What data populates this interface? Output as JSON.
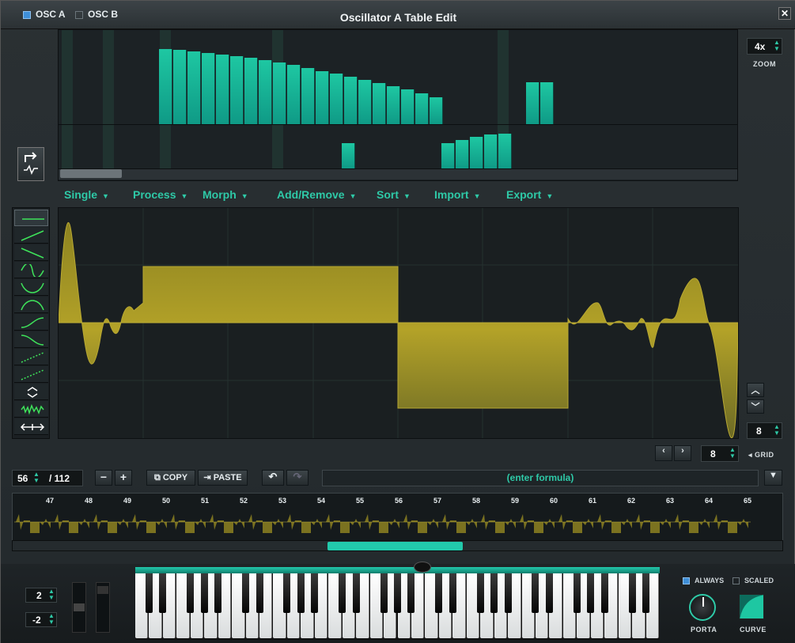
{
  "window": {
    "title": "Oscillator A Table Edit",
    "tabs": [
      {
        "label": "OSC A",
        "checked": true
      },
      {
        "label": "OSC B",
        "checked": false
      }
    ],
    "close_icon": "close-icon"
  },
  "zoom": {
    "value": "4x",
    "label": "ZOOM"
  },
  "menus": [
    {
      "label": "Single"
    },
    {
      "label": "Process"
    },
    {
      "label": "Morph"
    },
    {
      "label": "Add/Remove"
    },
    {
      "label": "Sort"
    },
    {
      "label": "Import"
    },
    {
      "label": "Export"
    }
  ],
  "shape_tools": [
    "flat-line-icon",
    "ramp-up-icon",
    "ramp-down-icon",
    "sine-icon",
    "half-sine-down-icon",
    "half-sine-up-icon",
    "s-curve-up-icon",
    "s-curve-down-icon",
    "dashed-ramp-icon",
    "dashed-ramp-2-icon",
    "expand-icon",
    "noise-icon",
    "stretch-icon"
  ],
  "grid": {
    "value": "8",
    "label": "GRID"
  },
  "snap": {
    "value": "8"
  },
  "frame": {
    "current": "56",
    "total": "/ 112"
  },
  "buttons": {
    "copy": "COPY",
    "paste": "PASTE"
  },
  "formula": {
    "placeholder": "(enter formula)"
  },
  "strip_labels": [
    "47",
    "48",
    "49",
    "50",
    "51",
    "52",
    "53",
    "54",
    "55",
    "56",
    "57",
    "58",
    "59",
    "60",
    "61",
    "62",
    "63",
    "64",
    "65"
  ],
  "keyboard": {
    "pitch_up": "2",
    "pitch_down": "-2",
    "always_label": "ALWAYS",
    "always_checked": true,
    "scaled_label": "SCALED",
    "scaled_checked": false,
    "porta_label": "PORTA",
    "curve_label": "CURVE"
  },
  "colors": {
    "accent": "#22c9ab",
    "wave": "#a39622"
  }
}
